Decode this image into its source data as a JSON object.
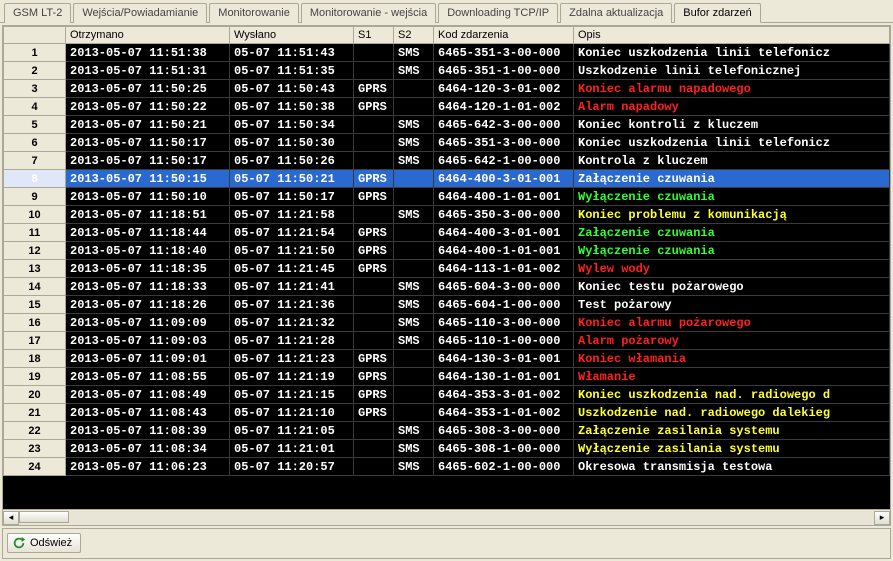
{
  "tabs": {
    "items": [
      {
        "label": "GSM LT-2"
      },
      {
        "label": "Wejścia/Powiadamianie"
      },
      {
        "label": "Monitorowanie"
      },
      {
        "label": "Monitorowanie - wejścia"
      },
      {
        "label": "Downloading TCP/IP"
      },
      {
        "label": "Zdalna aktualizacja"
      },
      {
        "label": "Bufor zdarzeń"
      }
    ],
    "active_index": 6
  },
  "grid": {
    "columns": {
      "rownum": "",
      "received": "Otrzymano",
      "sent": "Wysłano",
      "s1": "S1",
      "s2": "S2",
      "code": "Kod zdarzenia",
      "desc": "Opis"
    },
    "selected_index": 7,
    "rows": [
      {
        "n": "1",
        "received": "2013-05-07 11:51:38",
        "sent": "05-07 11:51:43",
        "s1": "",
        "s2": "SMS",
        "code": "6465-351-3-00-000",
        "desc": "Koniec uszkodzenia linii telefonicz",
        "color": "white"
      },
      {
        "n": "2",
        "received": "2013-05-07 11:51:31",
        "sent": "05-07 11:51:35",
        "s1": "",
        "s2": "SMS",
        "code": "6465-351-1-00-000",
        "desc": "Uszkodzenie linii telefonicznej",
        "color": "white"
      },
      {
        "n": "3",
        "received": "2013-05-07 11:50:25",
        "sent": "05-07 11:50:43",
        "s1": "GPRS",
        "s2": "",
        "code": "6464-120-3-01-002",
        "desc": "Koniec alarmu napadowego",
        "color": "red"
      },
      {
        "n": "4",
        "received": "2013-05-07 11:50:22",
        "sent": "05-07 11:50:38",
        "s1": "GPRS",
        "s2": "",
        "code": "6464-120-1-01-002",
        "desc": "Alarm napadowy",
        "color": "red"
      },
      {
        "n": "5",
        "received": "2013-05-07 11:50:21",
        "sent": "05-07 11:50:34",
        "s1": "",
        "s2": "SMS",
        "code": "6465-642-3-00-000",
        "desc": "Koniec kontroli z kluczem",
        "color": "white"
      },
      {
        "n": "6",
        "received": "2013-05-07 11:50:17",
        "sent": "05-07 11:50:30",
        "s1": "",
        "s2": "SMS",
        "code": "6465-351-3-00-000",
        "desc": "Koniec uszkodzenia linii telefonicz",
        "color": "white"
      },
      {
        "n": "7",
        "received": "2013-05-07 11:50:17",
        "sent": "05-07 11:50:26",
        "s1": "",
        "s2": "SMS",
        "code": "6465-642-1-00-000",
        "desc": "Kontrola z kluczem",
        "color": "white"
      },
      {
        "n": "8",
        "received": "2013-05-07 11:50:15",
        "sent": "05-07 11:50:21",
        "s1": "GPRS",
        "s2": "",
        "code": "6464-400-3-01-001",
        "desc": "Załączenie czuwania",
        "color": "green"
      },
      {
        "n": "9",
        "received": "2013-05-07 11:50:10",
        "sent": "05-07 11:50:17",
        "s1": "GPRS",
        "s2": "",
        "code": "6464-400-1-01-001",
        "desc": "Wyłączenie czuwania",
        "color": "green"
      },
      {
        "n": "10",
        "received": "2013-05-07 11:18:51",
        "sent": "05-07 11:21:58",
        "s1": "",
        "s2": "SMS",
        "code": "6465-350-3-00-000",
        "desc": "Koniec problemu z komunikacją",
        "color": "yellow"
      },
      {
        "n": "11",
        "received": "2013-05-07 11:18:44",
        "sent": "05-07 11:21:54",
        "s1": "GPRS",
        "s2": "",
        "code": "6464-400-3-01-001",
        "desc": "Załączenie czuwania",
        "color": "green"
      },
      {
        "n": "12",
        "received": "2013-05-07 11:18:40",
        "sent": "05-07 11:21:50",
        "s1": "GPRS",
        "s2": "",
        "code": "6464-400-1-01-001",
        "desc": "Wyłączenie czuwania",
        "color": "green"
      },
      {
        "n": "13",
        "received": "2013-05-07 11:18:35",
        "sent": "05-07 11:21:45",
        "s1": "GPRS",
        "s2": "",
        "code": "6464-113-1-01-002",
        "desc": "Wylew wody",
        "color": "red"
      },
      {
        "n": "14",
        "received": "2013-05-07 11:18:33",
        "sent": "05-07 11:21:41",
        "s1": "",
        "s2": "SMS",
        "code": "6465-604-3-00-000",
        "desc": "Koniec testu pożarowego",
        "color": "white"
      },
      {
        "n": "15",
        "received": "2013-05-07 11:18:26",
        "sent": "05-07 11:21:36",
        "s1": "",
        "s2": "SMS",
        "code": "6465-604-1-00-000",
        "desc": "Test pożarowy",
        "color": "white"
      },
      {
        "n": "16",
        "received": "2013-05-07 11:09:09",
        "sent": "05-07 11:21:32",
        "s1": "",
        "s2": "SMS",
        "code": "6465-110-3-00-000",
        "desc": "Koniec alarmu pożarowego",
        "color": "red"
      },
      {
        "n": "17",
        "received": "2013-05-07 11:09:03",
        "sent": "05-07 11:21:28",
        "s1": "",
        "s2": "SMS",
        "code": "6465-110-1-00-000",
        "desc": "Alarm pożarowy",
        "color": "red"
      },
      {
        "n": "18",
        "received": "2013-05-07 11:09:01",
        "sent": "05-07 11:21:23",
        "s1": "GPRS",
        "s2": "",
        "code": "6464-130-3-01-001",
        "desc": "Koniec włamania",
        "color": "red"
      },
      {
        "n": "19",
        "received": "2013-05-07 11:08:55",
        "sent": "05-07 11:21:19",
        "s1": "GPRS",
        "s2": "",
        "code": "6464-130-1-01-001",
        "desc": "Włamanie",
        "color": "red"
      },
      {
        "n": "20",
        "received": "2013-05-07 11:08:49",
        "sent": "05-07 11:21:15",
        "s1": "GPRS",
        "s2": "",
        "code": "6464-353-3-01-002",
        "desc": "Koniec uszkodzenia nad. radiowego d",
        "color": "yellow"
      },
      {
        "n": "21",
        "received": "2013-05-07 11:08:43",
        "sent": "05-07 11:21:10",
        "s1": "GPRS",
        "s2": "",
        "code": "6464-353-1-01-002",
        "desc": "Uszkodzenie nad. radiowego dalekieg",
        "color": "yellow"
      },
      {
        "n": "22",
        "received": "2013-05-07 11:08:39",
        "sent": "05-07 11:21:05",
        "s1": "",
        "s2": "SMS",
        "code": "6465-308-3-00-000",
        "desc": "Załączenie zasilania systemu",
        "color": "yellow"
      },
      {
        "n": "23",
        "received": "2013-05-07 11:08:34",
        "sent": "05-07 11:21:01",
        "s1": "",
        "s2": "SMS",
        "code": "6465-308-1-00-000",
        "desc": "Wyłączenie zasilania systemu",
        "color": "yellow"
      },
      {
        "n": "24",
        "received": "2013-05-07 11:06:23",
        "sent": "05-07 11:20:57",
        "s1": "",
        "s2": "SMS",
        "code": "6465-602-1-00-000",
        "desc": "Okresowa transmisja testowa",
        "color": "white"
      }
    ]
  },
  "footer": {
    "refresh_label": "Odśwież"
  }
}
